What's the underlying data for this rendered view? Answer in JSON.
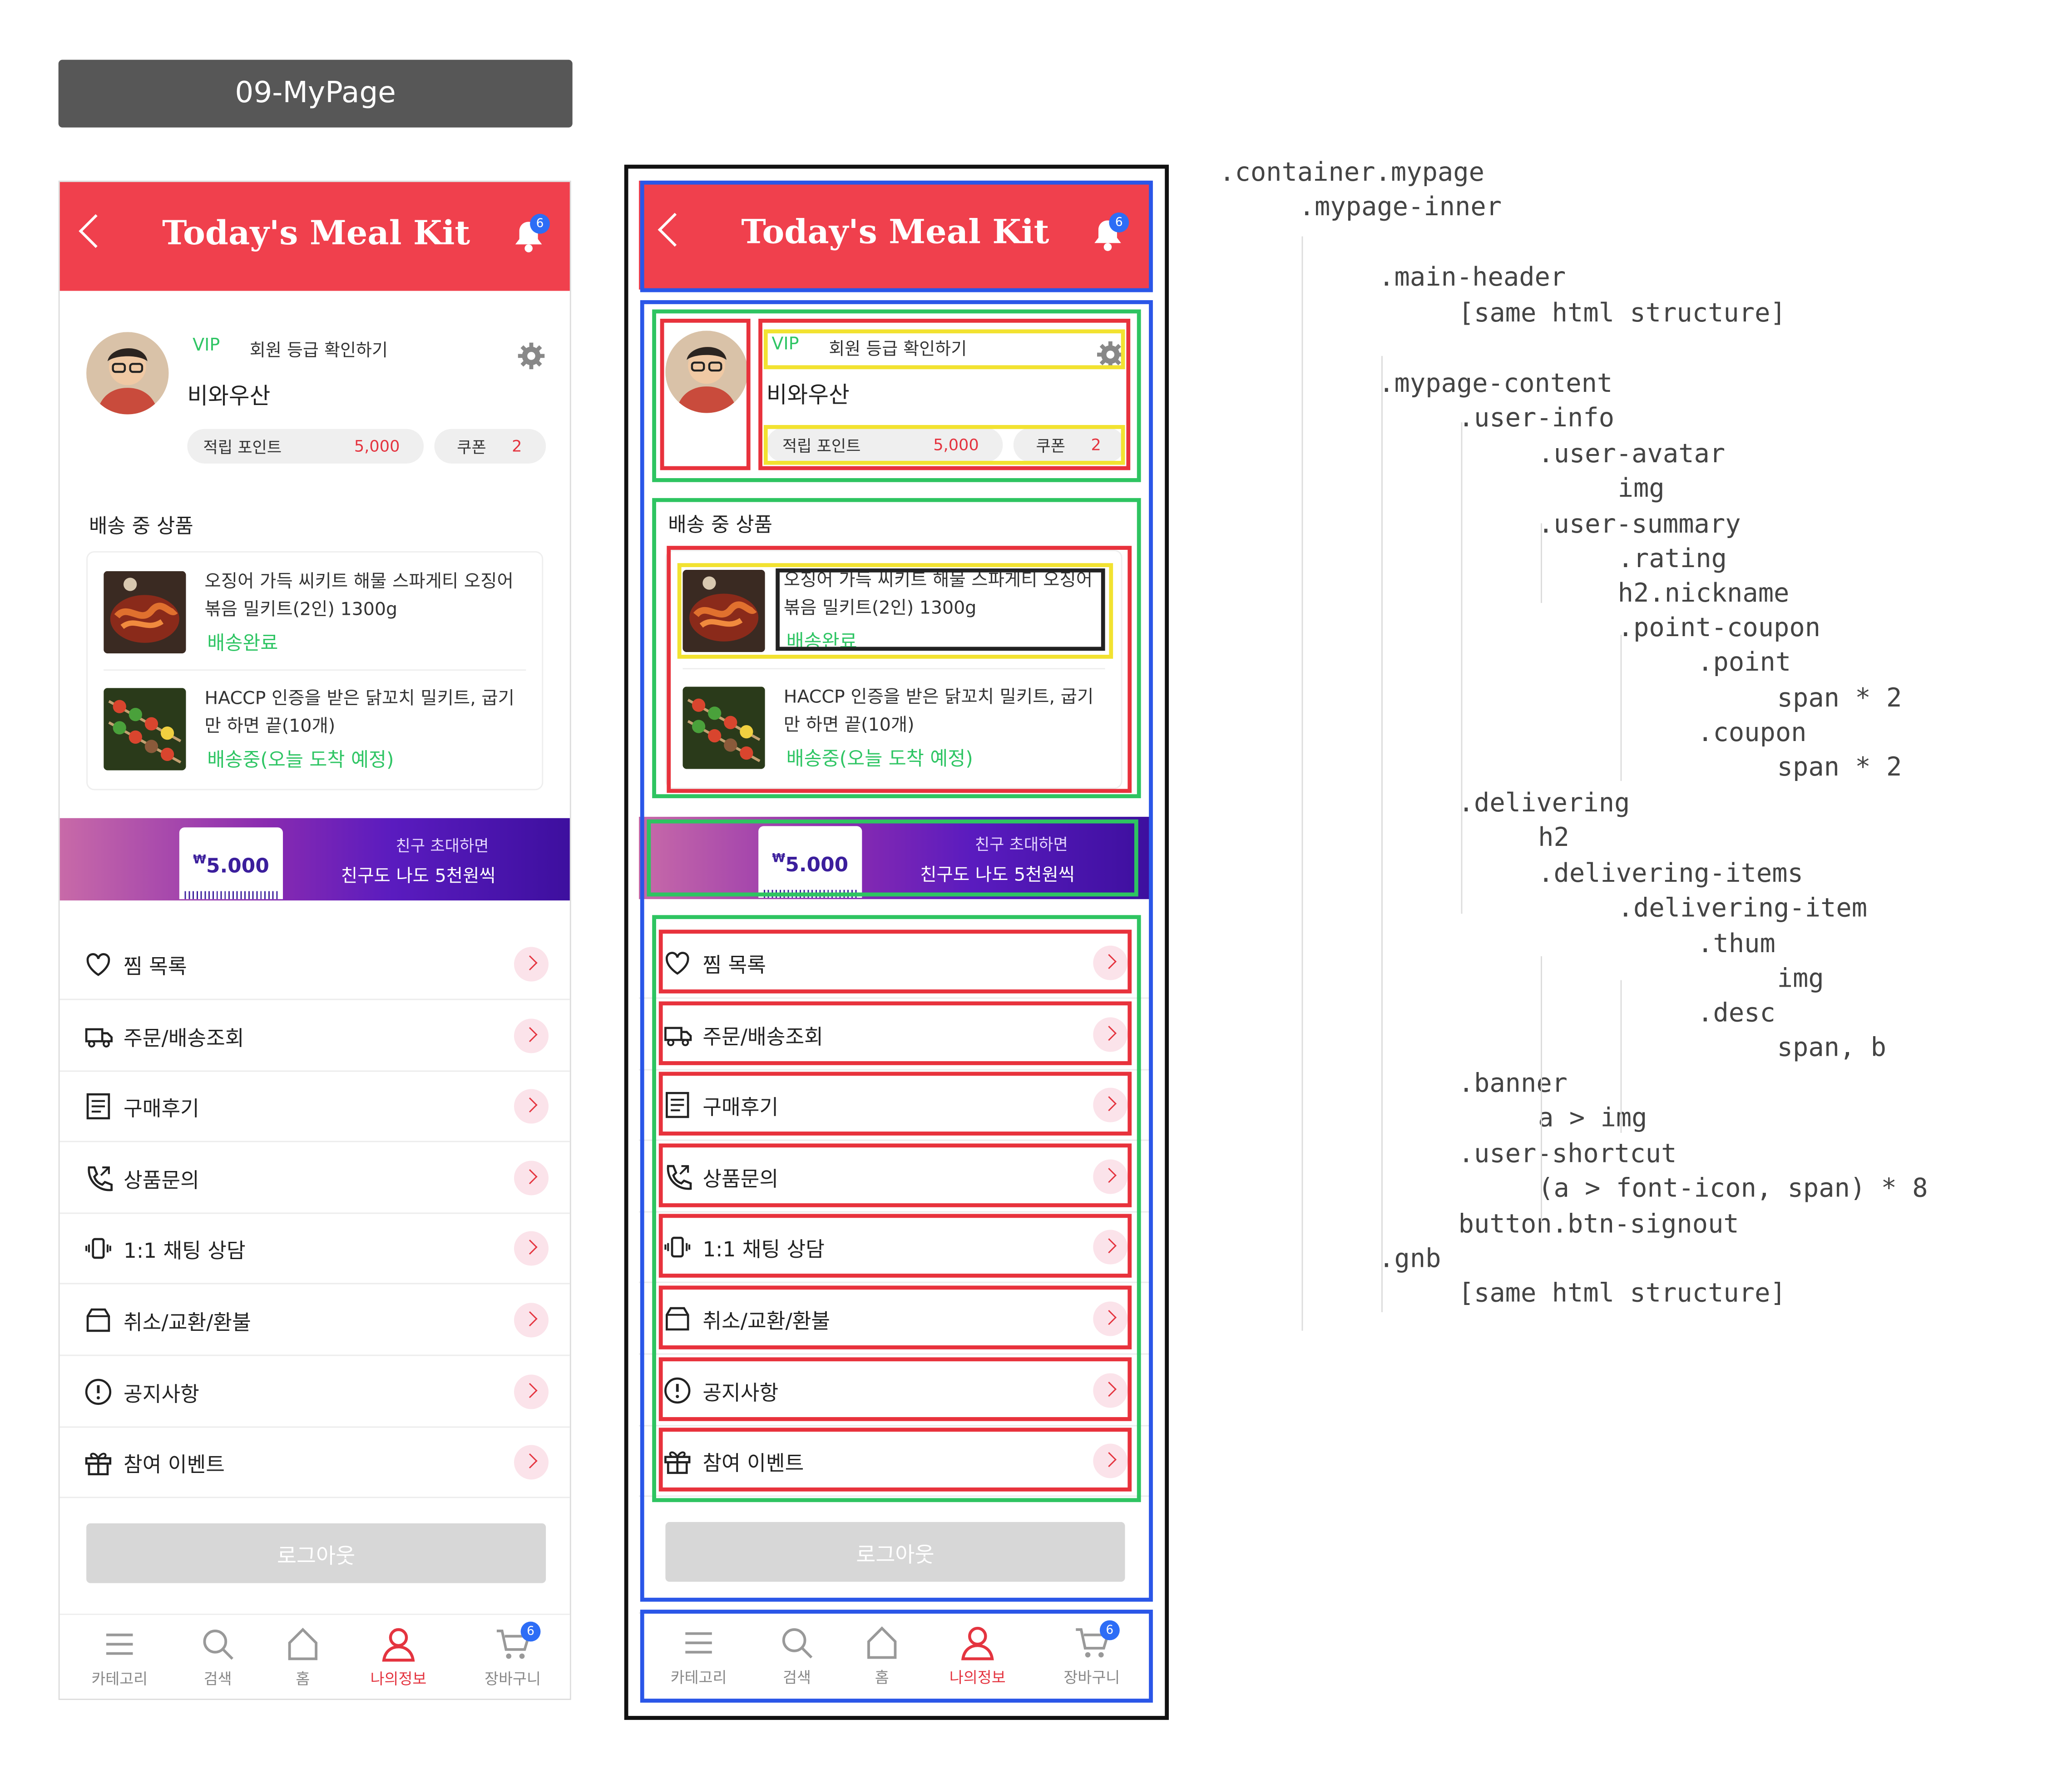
{
  "page_label": "09-MyPage",
  "header": {
    "title": "Today's Meal Kit",
    "bell_badge": "6"
  },
  "user": {
    "rating": "VIP",
    "rating_link": "회원 등급 확인하기",
    "nickname": "비와우산",
    "point_label": "적립 포인트",
    "point_value": "5,000",
    "coupon_label": "쿠폰",
    "coupon_value": "2"
  },
  "delivering": {
    "title": "배송 중 상품",
    "items": [
      {
        "desc": "오징어 가득 씨키트 해물 스파게티 오징어볶음 밀키트(2인) 1300g",
        "status": "배송완료"
      },
      {
        "desc": "HACCP 인증을 받은 닭꼬치 밀키트, 굽기만 하면 끝(10개)",
        "status": "배송중(오늘 도착 예정)"
      }
    ]
  },
  "banner": {
    "amount": "5.000",
    "line1": "친구 초대하면",
    "line2": "친구도 나도 5천원씩"
  },
  "shortcuts": [
    {
      "label": "찜 목록",
      "icon": "heart-icon"
    },
    {
      "label": "주문/배송조회",
      "icon": "truck-icon"
    },
    {
      "label": "구매후기",
      "icon": "review-icon"
    },
    {
      "label": "상품문의",
      "icon": "phone-icon"
    },
    {
      "label": "1:1 채팅 상담",
      "icon": "vibrate-icon"
    },
    {
      "label": "취소/교환/환불",
      "icon": "box-icon"
    },
    {
      "label": "공지사항",
      "icon": "notice-icon"
    },
    {
      "label": "참여 이벤트",
      "icon": "gift-icon"
    }
  ],
  "logout_label": "로그아웃",
  "gnb": [
    {
      "label": "카테고리",
      "icon": "menu-icon",
      "active": false
    },
    {
      "label": "검색",
      "icon": "search-icon",
      "active": false
    },
    {
      "label": "홈",
      "icon": "home-icon",
      "active": false
    },
    {
      "label": "나의정보",
      "icon": "user-icon",
      "active": true
    },
    {
      "label": "장바구니",
      "icon": "cart-icon",
      "active": false,
      "badge": "6"
    }
  ],
  "structure_tree": [
    ".container.mypage",
    ".mypage-inner",
    ".main-header",
    "[same html structure]",
    ".mypage-content",
    ".user-info",
    ".user-avatar",
    "img",
    ".user-summary",
    ".rating",
    "h2.nickname",
    ".point-coupon",
    ".point",
    "span * 2",
    ".coupon",
    "span * 2",
    ".delivering",
    "h2",
    ".delivering-items",
    ".delivering-item",
    ".thum",
    "img",
    ".desc",
    "span, b",
    ".banner",
    "a > img",
    ".user-shortcut",
    "(a > font-icon, span) * 8",
    "button.btn-signout",
    ".gnb",
    "[same html structure]"
  ],
  "colors": {
    "brand": "#f0404d",
    "accent_green": "#2fc564",
    "badge_blue": "#2d6df6",
    "label_bar": "#575757"
  }
}
